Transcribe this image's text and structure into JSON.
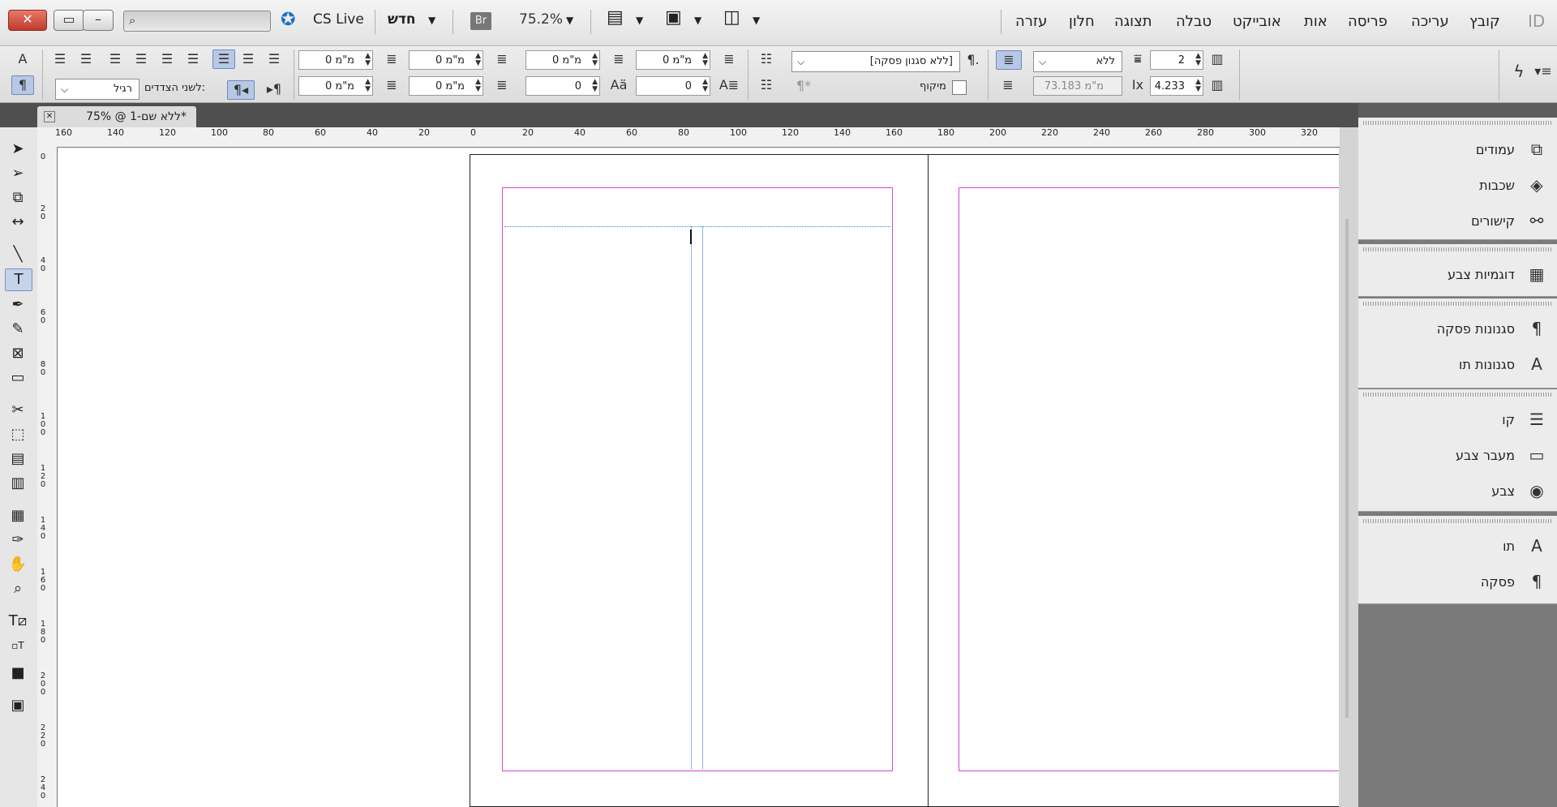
{
  "window": {
    "close": "✕",
    "cs_live": "CS Live",
    "new_doc": "חדש",
    "br": "Br",
    "zoom": "75.2%"
  },
  "menu": [
    "עזרה",
    "חלון",
    "תצוגה",
    "טבלה",
    "אובייקט",
    "אות",
    "פריסה",
    "עריכה",
    "קובץ"
  ],
  "app_logo": "ID",
  "control": {
    "indent_fields": [
      "0 מ\"מ",
      "0 מ\"מ",
      "0 מ\"מ",
      "0 מ\"מ",
      "0 מ\"מ",
      "0 מ\"מ",
      "0",
      "0"
    ],
    "paragraph_style": "[ללא סגנון פסקה]",
    "shading": "ללא",
    "columns": "2",
    "hyphenate": "מיקוף",
    "width": "73.183 מ\"מ",
    "gutter": "4.233",
    "both_sides": "לשני הצדדים:",
    "normal": "רגיל"
  },
  "doc_tab": "ללא שם-1 @ 75%*",
  "ruler": {
    "h": [
      "160",
      "140",
      "120",
      "100",
      "80",
      "60",
      "40",
      "20",
      "0",
      "20",
      "40",
      "60",
      "80",
      "100",
      "120",
      "140",
      "160",
      "180",
      "200",
      "220",
      "240",
      "260",
      "280",
      "300",
      "320"
    ],
    "v": [
      "0",
      "2 0",
      "4 0",
      "6 0",
      "8 0",
      "1 0 0",
      "1 2 0",
      "1 4 0",
      "1 6 0",
      "1 8 0",
      "2 0 0",
      "2 2 0",
      "2 4 0"
    ]
  },
  "panels": [
    {
      "items": [
        {
          "label": "עמודים",
          "icon": "pages-icon"
        },
        {
          "label": "שכבות",
          "icon": "layers-icon"
        },
        {
          "label": "קישורים",
          "icon": "links-icon"
        }
      ]
    },
    {
      "items": [
        {
          "label": "דוגמיות צבע",
          "icon": "swatches-icon"
        }
      ]
    },
    {
      "items": [
        {
          "label": "סגנונות פסקה",
          "icon": "paragraph-styles-icon"
        },
        {
          "label": "סגנונות תו",
          "icon": "character-styles-icon"
        }
      ]
    },
    {
      "items": [
        {
          "label": "קו",
          "icon": "stroke-icon"
        },
        {
          "label": "מעבר צבע",
          "icon": "gradient-icon"
        },
        {
          "label": "צבע",
          "icon": "color-icon"
        }
      ]
    },
    {
      "items": [
        {
          "label": "תו",
          "icon": "character-icon"
        },
        {
          "label": "פסקה",
          "icon": "paragraph-icon"
        }
      ]
    }
  ]
}
